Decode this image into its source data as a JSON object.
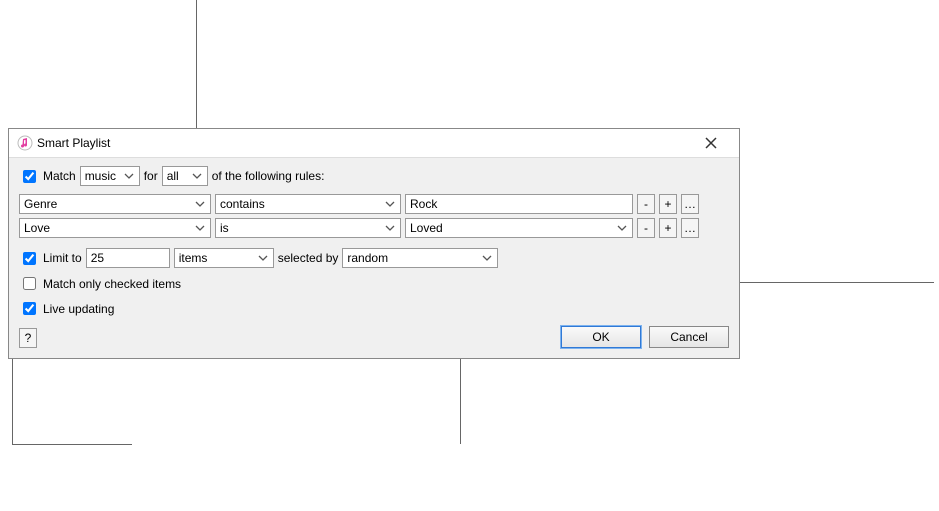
{
  "dialog": {
    "title": "Smart Playlist",
    "close_icon": "close"
  },
  "match": {
    "checked": true,
    "label": "Match",
    "media_type": "music",
    "for_label": "for",
    "scope": "all",
    "rules_label": "of the following rules:"
  },
  "rules": [
    {
      "field": "Genre",
      "operator": "contains",
      "value_type": "text",
      "value": "Rock"
    },
    {
      "field": "Love",
      "operator": "is",
      "value_type": "select",
      "value": "Loved"
    }
  ],
  "rule_buttons": {
    "remove": "-",
    "add": "+",
    "more": "…"
  },
  "limit": {
    "checked": true,
    "label": "Limit to",
    "count": "25",
    "unit": "items",
    "selected_by_label": "selected by",
    "method": "random"
  },
  "options": {
    "match_only_checked": {
      "checked": false,
      "label": "Match only checked items"
    },
    "live_updating": {
      "checked": true,
      "label": "Live updating"
    }
  },
  "help": "?",
  "buttons": {
    "ok": "OK",
    "cancel": "Cancel"
  }
}
